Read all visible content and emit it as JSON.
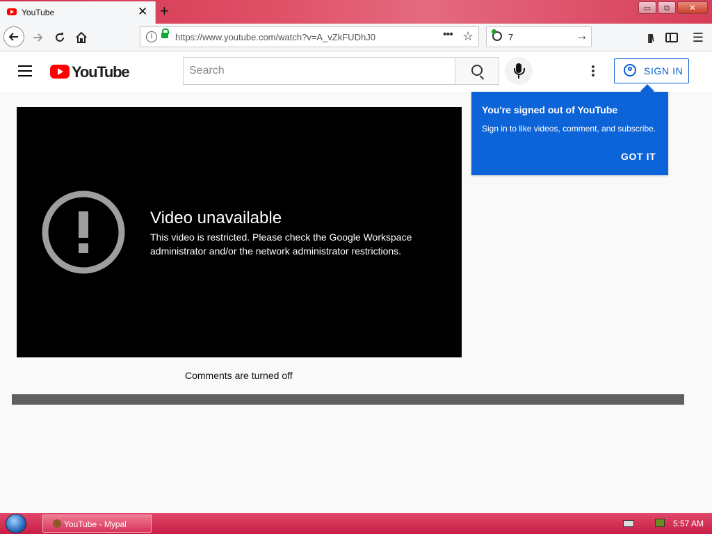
{
  "browser": {
    "tab_title": "YouTube",
    "tab_close": "✕",
    "new_tab": "+",
    "url": "https://www.youtube.com/watch?v=A_vZkFUDhJ0",
    "page_actions": "•••",
    "search_count": "7",
    "window_buttons": {
      "minimize": "▭",
      "restore": "⧉",
      "close": "✕"
    }
  },
  "youtube": {
    "logo_text": "YouTube",
    "search_placeholder": "Search",
    "signin_label": "SIGN IN"
  },
  "popup": {
    "title": "You're signed out of YouTube",
    "body": "Sign in to like videos, comment, and subscribe.",
    "button": "GOT IT"
  },
  "player": {
    "error_title": "Video unavailable",
    "error_message": "This video is restricted. Please check the Google Workspace administrator and/or the network administrator restrictions."
  },
  "comments_status": "Comments are turned off",
  "taskbar": {
    "task_label": "YouTube - Mypal",
    "clock": "5:57 AM"
  },
  "colors": {
    "youtube_red": "#ff0000",
    "link_blue": "#065fd4",
    "popup_blue": "#0d64d8",
    "taskbar_red": "#c81e45"
  }
}
